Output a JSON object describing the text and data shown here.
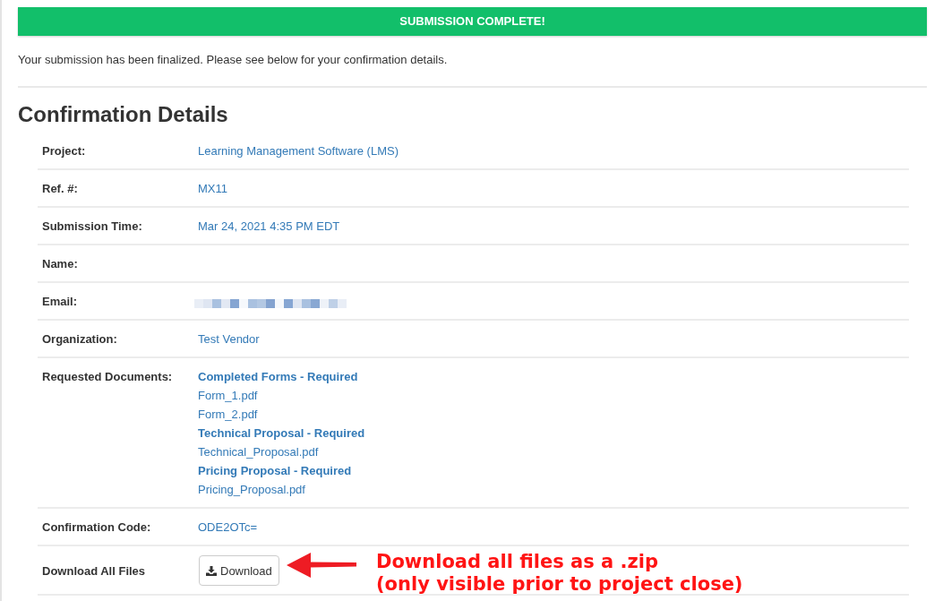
{
  "banner": {
    "title": "SUBMISSION COMPLETE!"
  },
  "message": "Your submission has been finalized. Please see below for your confirmation details.",
  "section": {
    "heading": "Confirmation Details",
    "rows": [
      {
        "kind": "text",
        "label": "Project:",
        "value": "Learning Management Software (LMS)"
      },
      {
        "kind": "text",
        "label": "Ref. #:",
        "value": "MX11"
      },
      {
        "kind": "text",
        "label": "Submission Time:",
        "value": "Mar 24, 2021 4:35 PM EDT"
      },
      {
        "kind": "text",
        "label": "Name:"
      },
      {
        "kind": "redacted",
        "label": "Email:"
      },
      {
        "kind": "text",
        "label": "Organization:",
        "value": "Test Vendor"
      },
      {
        "kind": "documents",
        "label": "Requested Documents:",
        "groups": [
          {
            "title": "Completed Forms - Required",
            "files": [
              "Form_1.pdf",
              "Form_2.pdf"
            ]
          },
          {
            "title": "Technical Proposal - Required",
            "files": [
              "Technical_Proposal.pdf"
            ]
          },
          {
            "title": "Pricing Proposal - Required",
            "files": [
              "Pricing_Proposal.pdf"
            ]
          }
        ]
      },
      {
        "kind": "text",
        "label": "Confirmation Code:",
        "value": "ODE2OTc="
      },
      {
        "kind": "button",
        "label": "Download All Files",
        "button": "Download"
      }
    ]
  },
  "callout": {
    "lines": [
      "Download all files as a .zip",
      "(only visible prior to project close)"
    ]
  }
}
